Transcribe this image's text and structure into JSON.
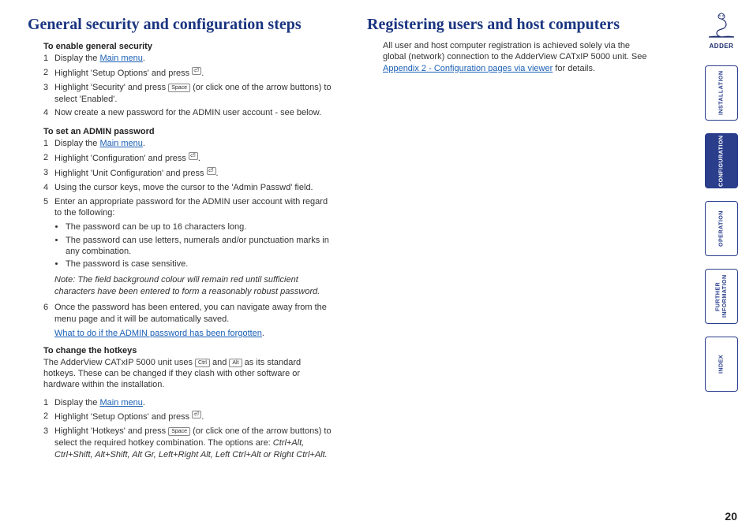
{
  "left": {
    "heading": "General security and configuration steps",
    "section1": {
      "title": "To enable general security",
      "steps": [
        {
          "n": "1",
          "pre": "Display the ",
          "link": "Main menu",
          "post": "."
        },
        {
          "n": "2",
          "pre": "Highlight 'Setup Options' and press ",
          "key": "enter",
          "post": "."
        },
        {
          "n": "3",
          "pre": "Highlight 'Security' and press ",
          "key": "Space",
          "post": " (or click one of the arrow buttons) to select 'Enabled'."
        },
        {
          "n": "4",
          "pre": "Now create a new password for the ADMIN user account - see below.",
          "key": null,
          "post": ""
        }
      ]
    },
    "section2": {
      "title": "To set an ADMIN password",
      "steps": [
        {
          "n": "1",
          "pre": "Display the ",
          "link": "Main menu",
          "post": "."
        },
        {
          "n": "2",
          "pre": "Highlight 'Configuration' and press ",
          "key": "enter",
          "post": "."
        },
        {
          "n": "3",
          "pre": "Highlight 'Unit Configuration' and press ",
          "key": "enter",
          "post": "."
        },
        {
          "n": "4",
          "pre": "Using the cursor keys, move the cursor to the 'Admin Passwd' field.",
          "key": null,
          "post": ""
        },
        {
          "n": "5",
          "pre": "Enter an appropriate password for the ADMIN user account with regard to the following:",
          "key": null,
          "post": ""
        }
      ],
      "bullets": [
        "The password can be up to 16 characters long.",
        "The password can use letters, numerals and/or punctuation marks in any combination.",
        "The password is case sensitive."
      ],
      "note": "Note: The field background colour will remain red until sufficient characters have been entered to form a reasonably robust password.",
      "step6": {
        "n": "6",
        "pre": "Once the password has been entered, you can navigate away from the menu page and it will be automatically saved.",
        "key": null,
        "post": ""
      },
      "linktext": "What to do if the ADMIN password has been forgotten",
      "linksuffix": "."
    },
    "section3": {
      "title": "To change the hotkeys",
      "intro_pre": "The AdderView CATxIP 5000 unit uses ",
      "intro_key1": "Ctrl",
      "intro_mid": " and ",
      "intro_key2": "Alt",
      "intro_post": " as its standard hotkeys. These can be changed if they clash with other software or hardware within the installation.",
      "steps": [
        {
          "n": "1",
          "pre": "Display the ",
          "link": "Main menu",
          "post": "."
        },
        {
          "n": "2",
          "pre": "Highlight 'Setup Options' and press ",
          "key": "enter",
          "post": "."
        },
        {
          "n": "3",
          "pre": "Highlight 'Hotkeys' and press ",
          "key": "Space",
          "post": " (or click one of the arrow buttons) to select the required hotkey combination. The options are: ",
          "opts": "Ctrl+Alt, Ctrl+Shift, Alt+Shift, Alt Gr, Left+Right Alt, Left Ctrl+Alt or Right Ctrl+Alt."
        }
      ]
    }
  },
  "right": {
    "heading": "Registering users and host computers",
    "body_pre": "All user and host computer registration is achieved solely via the global (network) connection to the AdderView CATxIP 5000 unit. See ",
    "link": "Appendix 2 - Configuration pages via viewer",
    "body_post": " for details."
  },
  "sidebar": {
    "brand": "ADDER",
    "tabs": [
      {
        "label": "INSTALLATION",
        "active": false
      },
      {
        "label": "CONFIGURATION",
        "active": true
      },
      {
        "label": "OPERATION",
        "active": false
      },
      {
        "label": "FURTHER\nINFORMATION",
        "active": false
      },
      {
        "label": "INDEX",
        "active": false
      }
    ]
  },
  "page_number": "20"
}
